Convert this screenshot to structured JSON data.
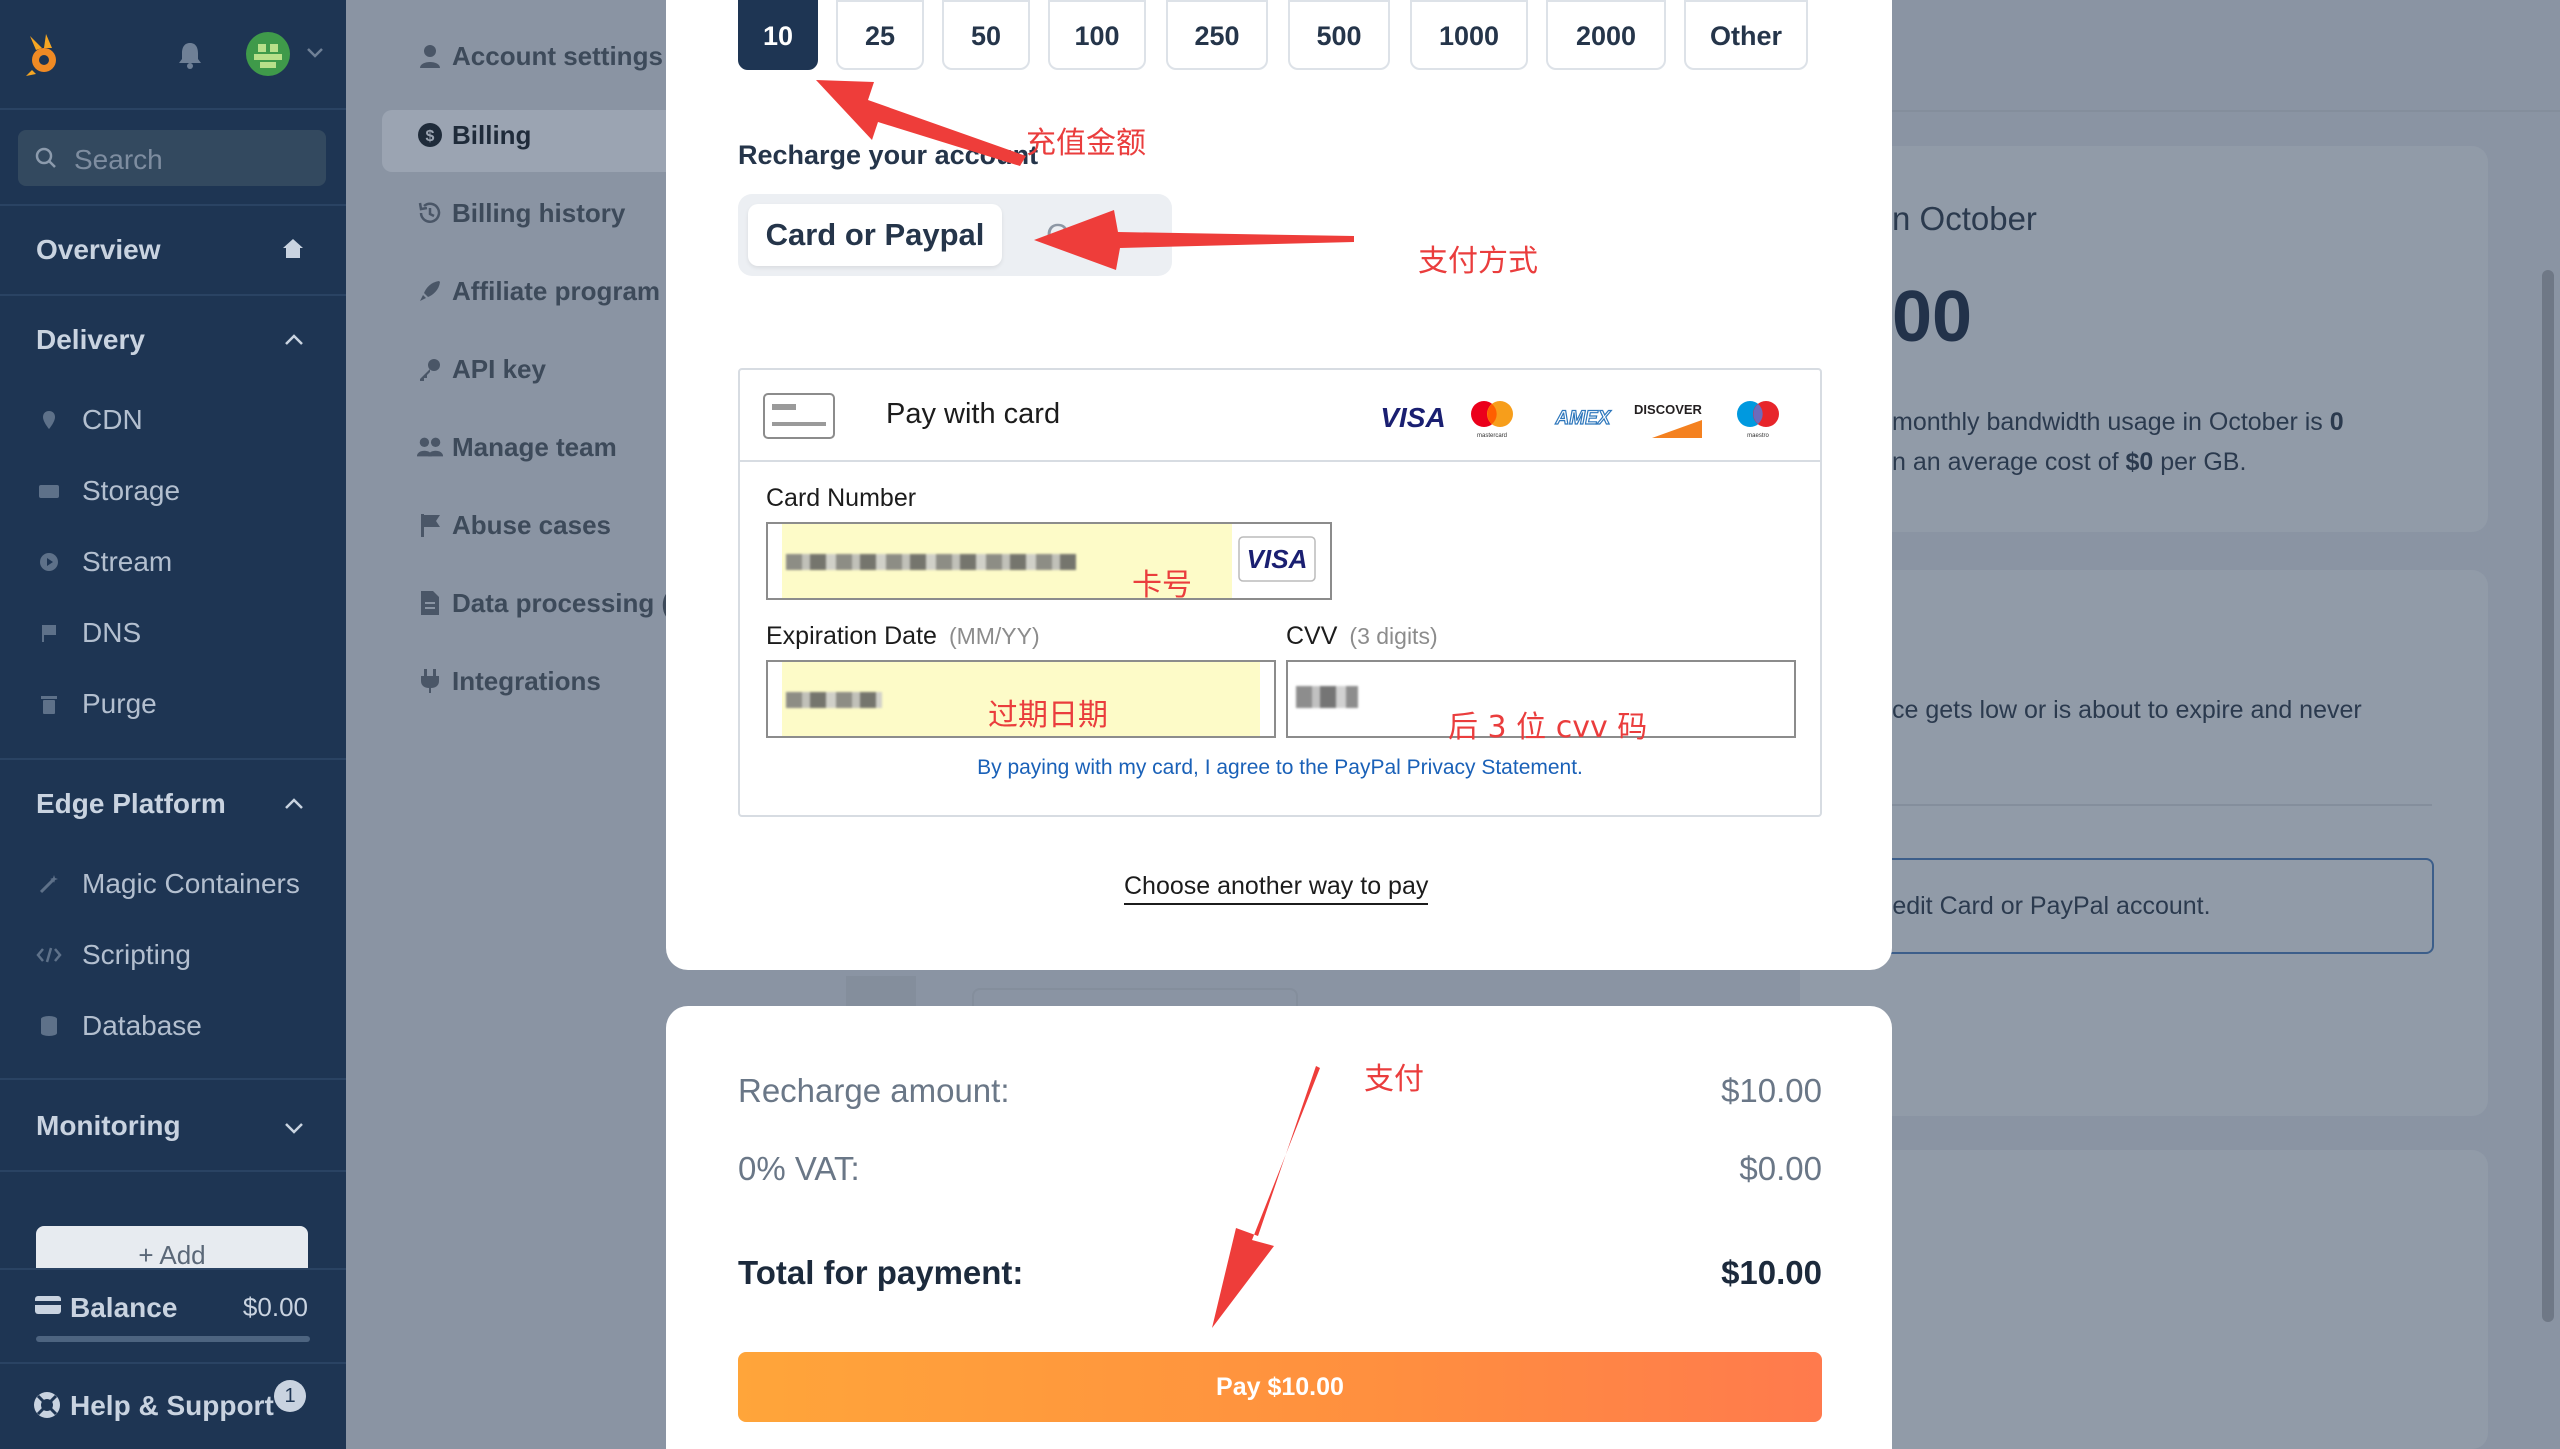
{
  "sidebar": {
    "search_placeholder": "Search",
    "overview": "Overview",
    "delivery": "Delivery",
    "delivery_items": [
      "CDN",
      "Storage",
      "Stream",
      "DNS",
      "Purge"
    ],
    "edge_platform": "Edge Platform",
    "edge_items": [
      "Magic Containers",
      "Scripting",
      "Database"
    ],
    "monitoring": "Monitoring",
    "add_label": "+ Add",
    "balance_label": "Balance",
    "balance_value": "$0.00",
    "help_label": "Help & Support",
    "help_count": "1"
  },
  "subnav": {
    "items": [
      "Account settings",
      "Billing",
      "Billing history",
      "Affiliate program",
      "API key",
      "Manage team",
      "Abuse cases",
      "Data processing (",
      "Integrations"
    ],
    "active": "Billing"
  },
  "background": {
    "card_title": "n October",
    "card_amount": "00",
    "usage_line1_a": "monthly bandwidth usage in October is ",
    "usage_line1_b": "0",
    "usage_line2_a": "n an average cost of ",
    "usage_line2_b": "$0",
    "usage_line2_c": " per GB.",
    "notice": "ce gets low or is about to expire and never",
    "button_text": "redit Card or PayPal account."
  },
  "modal": {
    "amounts": [
      "10",
      "25",
      "50",
      "100",
      "250",
      "500",
      "1000",
      "2000",
      "Other"
    ],
    "selected_amount": "10",
    "recharge_title": "Recharge your account",
    "method_selected": "Card or Paypal",
    "method_other": "C",
    "card_form": {
      "title": "Pay with card",
      "brands": [
        "VISA",
        "mastercard",
        "AMEX",
        "DISCOVER",
        "maestro"
      ],
      "card_number_label": "Card Number",
      "expiry_label": "Expiration Date",
      "expiry_hint": "(MM/YY)",
      "cvv_label": "CVV",
      "cvv_hint": "(3 digits)",
      "agree_text": "By paying with my card, I agree to the PayPal Privacy Statement."
    },
    "another_way": "Choose another way to pay",
    "summary": {
      "recharge_label": "Recharge amount:",
      "recharge_value": "$10.00",
      "vat_label": "0% VAT:",
      "vat_value": "$0.00",
      "total_label": "Total for payment:",
      "total_value": "$10.00"
    },
    "pay_button": "Pay $10.00"
  },
  "annotations": {
    "amount": "充值金额",
    "method": "支付方式",
    "card_number": "卡号",
    "expiry": "过期日期",
    "cvv": "后 3 位 cvv 码",
    "pay": "支付"
  },
  "colors": {
    "sidebar": "#1e3553",
    "accent_orange": "#ff8f3f",
    "annotation_red": "#ea3d3d",
    "link_blue": "#1a61b8"
  }
}
